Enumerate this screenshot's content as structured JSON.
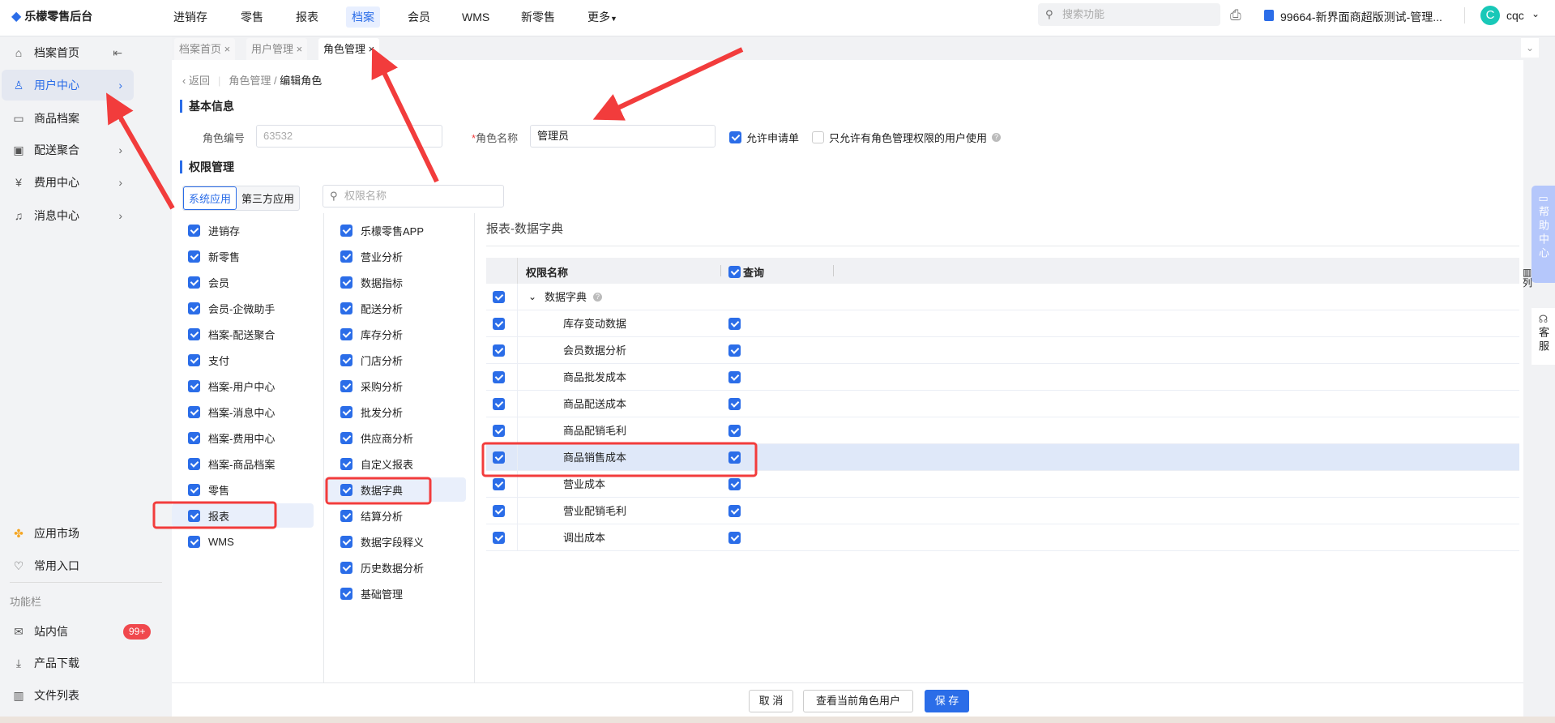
{
  "app": {
    "title": "乐檬零售后台"
  },
  "topnav": {
    "items": [
      "进销存",
      "零售",
      "报表",
      "档案",
      "会员",
      "WMS",
      "新零售",
      "更多"
    ],
    "active": "档案",
    "search_placeholder": "搜索功能",
    "store": "99664-新界面商超版测试-管理...",
    "user": "cqc",
    "avatar_letter": "C"
  },
  "sidebar": {
    "items": [
      {
        "label": "档案首页"
      },
      {
        "label": "用户中心",
        "active": true
      },
      {
        "label": "商品档案"
      },
      {
        "label": "配送聚合"
      },
      {
        "label": "费用中心"
      },
      {
        "label": "消息中心"
      }
    ],
    "market": "应用市场",
    "favorites": "常用入口",
    "section": "功能栏",
    "messages": "站内信",
    "messages_badge": "99+",
    "download": "产品下载",
    "files": "文件列表"
  },
  "tabs": [
    {
      "label": "档案首页"
    },
    {
      "label": "用户管理"
    },
    {
      "label": "角色管理",
      "active": true
    }
  ],
  "breadcrumb": {
    "back": "返回",
    "parent": "角色管理",
    "current": "编辑角色"
  },
  "basic": {
    "title": "基本信息",
    "code_label": "角色编号",
    "code_value": "63532",
    "name_label": "角色名称",
    "name_value": "管理员",
    "allow_label": "允许申请单",
    "allow_checked": true,
    "restrict_label": "只允许有角色管理权限的用户使用",
    "restrict_checked": false
  },
  "perm": {
    "title": "权限管理",
    "app_tabs": [
      "系统应用",
      "第三方应用"
    ],
    "search_placeholder": "权限名称",
    "modules": [
      "进销存",
      "新零售",
      "会员",
      "会员-企微助手",
      "档案-配送聚合",
      "支付",
      "档案-用户中心",
      "档案-消息中心",
      "档案-费用中心",
      "档案-商品档案",
      "零售",
      "报表",
      "WMS"
    ],
    "selected_module": "报表",
    "submodules": [
      "乐檬零售APP",
      "营业分析",
      "数据指标",
      "配送分析",
      "库存分析",
      "门店分析",
      "采购分析",
      "批发分析",
      "供应商分析",
      "自定义报表",
      "数据字典",
      "结算分析",
      "数据字段释义",
      "历史数据分析",
      "基础管理"
    ],
    "selected_submodule": "数据字典",
    "panel_title": "报表-数据字典",
    "table": {
      "col_name": "权限名称",
      "col_query": "查询",
      "column_setting": "列",
      "group": "数据字典",
      "rows": [
        {
          "name": "库存变动数据"
        },
        {
          "name": "会员数据分析"
        },
        {
          "name": "商品批发成本"
        },
        {
          "name": "商品配送成本"
        },
        {
          "name": "商品配销毛利"
        },
        {
          "name": "商品销售成本",
          "selected": true
        },
        {
          "name": "营业成本"
        },
        {
          "name": "营业配销毛利"
        },
        {
          "name": "调出成本"
        }
      ]
    }
  },
  "footer": {
    "cancel": "取 消",
    "view_users": "查看当前角色用户",
    "save": "保 存"
  },
  "float": {
    "help": "帮助中心",
    "service": "客服"
  },
  "colors": {
    "accent": "#2b6de8",
    "annotation": "#f23c3c",
    "badge": "#f0484d"
  }
}
